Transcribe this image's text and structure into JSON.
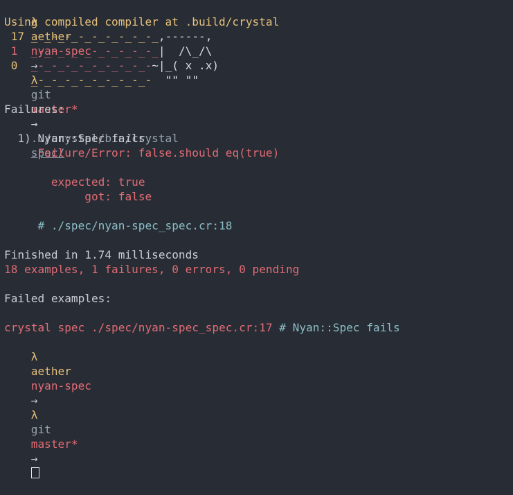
{
  "prompt": {
    "lambda": "λ",
    "user": "aether",
    "dir": "nyan-spec",
    "arrow1": "→",
    "lambda2": "λ",
    "git": "git",
    "branch": "master*",
    "arrow2": "→",
    "command": "../crystal/bin/crystal",
    "arg": "spec/"
  },
  "compile_line": "Using compiled compiler at .build/crystal",
  "nyan": {
    "row1_count": "17",
    "row1_trail": "_-_-_-_-_-_-_-_-_-_",
    "row1_cat": ",------,",
    "row2_count": "1",
    "row2_trail": "_-_-_-_-_-_-_-_-_-_",
    "row2_cat": "|  /\\_/\\",
    "row3_count": "0",
    "row3_trail": "_-_-_-_-_-_-_-_-_-",
    "row3_cat": "~|_( x .x)",
    "row4_trail": "_-_-_-_-_-_-_-_-_-",
    "row4_cat": "\"\" \"\""
  },
  "failures_header": "Failures:",
  "failure": {
    "index": "1)",
    "title": "Nyan::Spec fails",
    "error": "Failure/Error: false.should eq(true)",
    "expected_label": "expected:",
    "expected_value": "true",
    "got_label": "got:",
    "got_value": "false",
    "location": "# ./spec/nyan-spec_spec.cr:18"
  },
  "finished": "Finished in 1.74 milliseconds",
  "summary": "18 examples, 1 failures, 0 errors, 0 pending",
  "failed_examples_header": "Failed examples:",
  "failed_example": {
    "command": "crystal spec ./spec/nyan-spec_spec.cr:17",
    "comment": "# Nyan::Spec fails"
  },
  "prompt_bottom": {
    "lambda": "λ",
    "user": "aether",
    "dir": "nyan-spec",
    "arrow1": "→",
    "lambda2": "λ",
    "git": "git",
    "branch": "master*",
    "arrow2": "→"
  },
  "colors": {
    "background": "#282c34",
    "prompt_yellow": "#e5c07b",
    "failure_red": "#e06c75",
    "location_cyan": "#8bbec7"
  }
}
